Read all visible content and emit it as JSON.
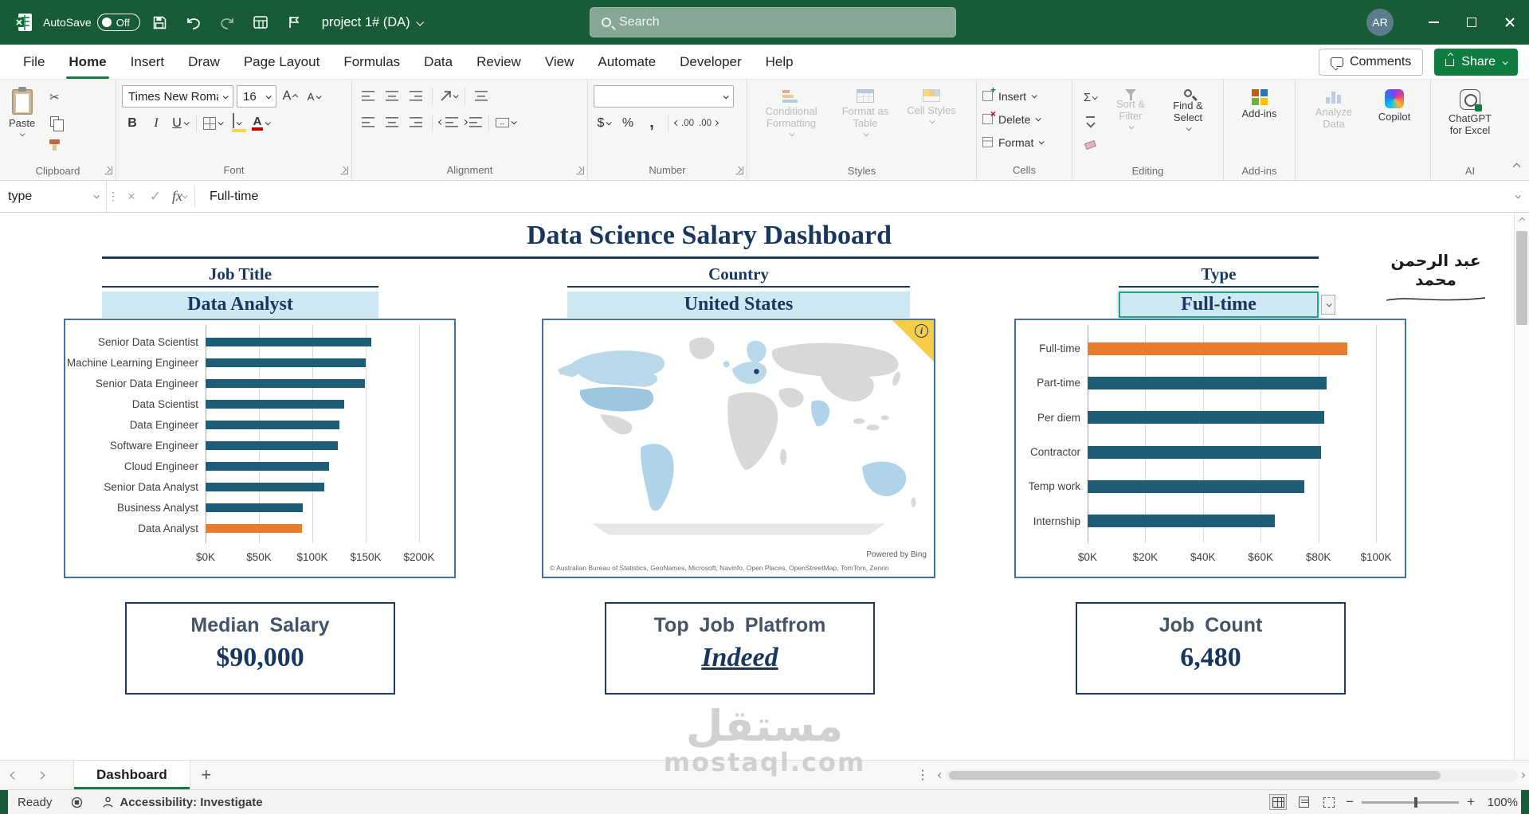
{
  "titlebar": {
    "autosave_label": "AutoSave",
    "autosave_state": "Off",
    "workbook_name": "project 1# (DA)",
    "search_placeholder": "Search",
    "avatar_initials": "AR"
  },
  "menu": {
    "tabs": [
      {
        "label": "File",
        "active": false
      },
      {
        "label": "Home",
        "active": true
      },
      {
        "label": "Insert",
        "active": false
      },
      {
        "label": "Draw",
        "active": false
      },
      {
        "label": "Page Layout",
        "active": false
      },
      {
        "label": "Formulas",
        "active": false
      },
      {
        "label": "Data",
        "active": false
      },
      {
        "label": "Review",
        "active": false
      },
      {
        "label": "View",
        "active": false
      },
      {
        "label": "Automate",
        "active": false
      },
      {
        "label": "Developer",
        "active": false
      },
      {
        "label": "Help",
        "active": false
      }
    ],
    "comments_label": "Comments",
    "share_label": "Share"
  },
  "ribbon": {
    "clipboard": {
      "label": "Clipboard",
      "paste": "Paste"
    },
    "font": {
      "label": "Font",
      "name": "Times New Romar",
      "size": "16"
    },
    "alignment": {
      "label": "Alignment"
    },
    "number": {
      "label": "Number",
      "format_value": ""
    },
    "styles": {
      "label": "Styles",
      "conditional_formatting": "Conditional Formatting",
      "format_as_table": "Format as Table",
      "cell_styles": "Cell Styles"
    },
    "cells": {
      "label": "Cells",
      "insert": "Insert",
      "delete": "Delete",
      "format": "Format"
    },
    "editing": {
      "label": "Editing",
      "sort_filter": "Sort & Filter",
      "find_select": "Find & Select"
    },
    "addins": {
      "label": "Add-ins",
      "addins": "Add-ins",
      "analyze_data": "Analyze Data",
      "copilot": "Copilot"
    },
    "ai": {
      "label": "AI",
      "chatgpt": "ChatGPT for Excel"
    }
  },
  "formula_bar": {
    "name_box": "type",
    "fx": "fx",
    "formula": "Full-time"
  },
  "dashboard": {
    "title": "Data Science Salary Dashboard",
    "signature": "عبد الرحمن محمد",
    "columns": [
      {
        "header": "Job Title",
        "slicer_value": "Data Analyst"
      },
      {
        "header": "Country",
        "slicer_value": "United States"
      },
      {
        "header": "Type",
        "slicer_value": "Full-time"
      }
    ],
    "cards": [
      {
        "label": "Median Salary",
        "value": "$90,000"
      },
      {
        "label": "Top Job Platfrom",
        "value": "Indeed"
      },
      {
        "label": "Job Count",
        "value": "6,480"
      }
    ]
  },
  "chart_data": [
    {
      "type": "bar",
      "orientation": "horizontal",
      "title": "",
      "categories": [
        "Senior Data Scientist",
        "Machine Learning Engineer",
        "Senior Data Engineer",
        "Data Scientist",
        "Data Engineer",
        "Software Engineer",
        "Cloud Engineer",
        "Senior Data Analyst",
        "Business Analyst",
        "Data Analyst"
      ],
      "values": [
        155,
        150,
        149,
        130,
        125,
        124,
        116,
        111,
        91,
        90
      ],
      "unit": "USD thousands",
      "xlim": [
        0,
        200
      ],
      "ticks": [
        "$0K",
        "$50K",
        "$100K",
        "$150K",
        "$200K"
      ],
      "highlight_category": "Data Analyst",
      "bar_color": "#1F5C78",
      "highlight_color": "#E87D2E",
      "grid": true,
      "legend": false
    },
    {
      "type": "map",
      "title": "",
      "highlighted": [
        "United States"
      ],
      "powered_by": "Powered by Bing",
      "attribution": "© Australian Bureau of Statistics, GeoNames, Microsoft, Navinfo, Open Places, OpenStreetMap, TomTom, Zenrin"
    },
    {
      "type": "bar",
      "orientation": "horizontal",
      "title": "",
      "categories": [
        "Full-time",
        "Part-time",
        "Per diem",
        "Contractor",
        "Temp work",
        "Internship"
      ],
      "values": [
        90,
        83,
        82,
        81,
        75,
        65
      ],
      "unit": "USD thousands",
      "xlim": [
        0,
        100
      ],
      "ticks": [
        "$0K",
        "$20K",
        "$40K",
        "$60K",
        "$80K",
        "$100K"
      ],
      "highlight_category": "Full-time",
      "bar_color": "#1F5C78",
      "highlight_color": "#E87D2E",
      "grid": true,
      "legend": false
    }
  ],
  "watermark": {
    "arabic": "مستقل",
    "latin": "mostaql.com"
  },
  "sheet_bar": {
    "active_tab": "Dashboard"
  },
  "status_bar": {
    "ready": "Ready",
    "accessibility": "Accessibility: Investigate",
    "zoom_level": "100%"
  }
}
